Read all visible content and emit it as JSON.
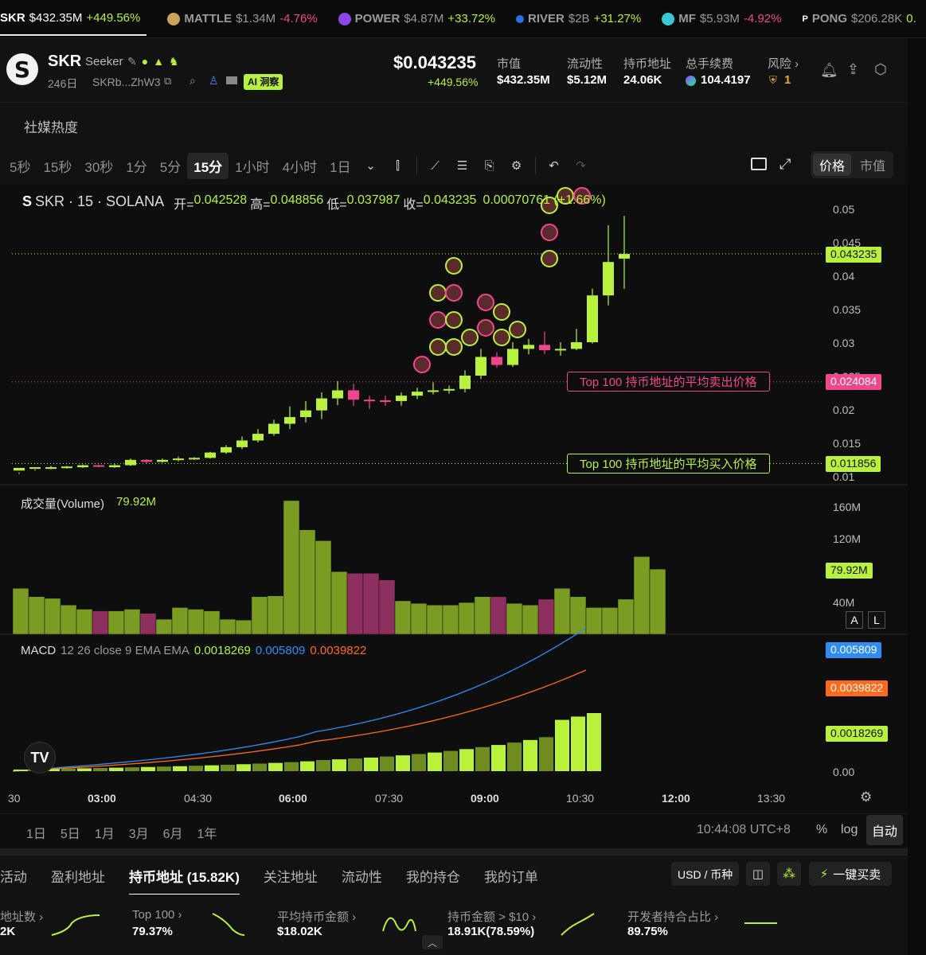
{
  "ticker": [
    {
      "symbol": "SKR",
      "value": "$432.35M",
      "change": "+449.56%",
      "dir": "up",
      "active": true
    },
    {
      "symbol": "MATTLE",
      "value": "$1.34M",
      "change": "-4.76%",
      "dir": "down"
    },
    {
      "symbol": "POWER",
      "value": "$4.87M",
      "change": "+33.72%",
      "dir": "up"
    },
    {
      "symbol": "RIVER",
      "value": "$2B",
      "change": "+31.27%",
      "dir": "up"
    },
    {
      "symbol": "MF",
      "value": "$5.93M",
      "change": "-4.92%",
      "dir": "down"
    },
    {
      "symbol": "PONG",
      "value": "$206.28K",
      "change": "0.",
      "dir": "up"
    }
  ],
  "header": {
    "symbol": "SKR",
    "name": "Seeker",
    "age": "246日",
    "address": "SKRb...ZhW3",
    "ai_badge": "AI 洞察",
    "price": "$0.043235",
    "price_change": "+449.56%",
    "stats": [
      {
        "label": "市值",
        "value": "$432.35M"
      },
      {
        "label": "流动性",
        "value": "$5.12M"
      },
      {
        "label": "持币地址",
        "value": "24.06K"
      },
      {
        "label": "总手续费",
        "value": "104.4197"
      },
      {
        "label": "风险 ›",
        "value": "1"
      }
    ]
  },
  "social": {
    "label": "社媒热度"
  },
  "toolbar": {
    "timeframes": [
      "5秒",
      "15秒",
      "30秒",
      "1分",
      "5分",
      "15分",
      "1小时",
      "4小时",
      "1日"
    ],
    "active": "15分",
    "price_toggle": "价格",
    "mcap_toggle": "市值"
  },
  "chart_data": {
    "type": "candlestick",
    "legend": {
      "title": "SKR · 15 · SOLANA",
      "open_label": "开=",
      "open": "0.042528",
      "high_label": "高=",
      "high": "0.048856",
      "low_label": "低=",
      "low": "0.037987",
      "close_label": "收=",
      "close": "0.043235",
      "change": "0.00070761 (+1.66%)"
    },
    "price_axis": [
      "0.05",
      "0.045",
      "0.04",
      "0.035",
      "0.03",
      "0.025",
      "0.02",
      "0.015",
      "0.01"
    ],
    "price_tags": {
      "current": "0.043235",
      "avg_sell": "0.024084",
      "avg_buy": "0.011856"
    },
    "avg_sell_label": "Top 100 持币地址的平均卖出价格",
    "avg_buy_label": "Top 100 持币地址的平均买入价格",
    "candles": [
      [
        0.0108,
        0.0112,
        0.0105,
        0.0103
      ],
      [
        0.0112,
        0.0113,
        0.011,
        0.0108
      ],
      [
        0.0112,
        0.0113,
        0.0115,
        0.011
      ],
      [
        0.0112,
        0.0114,
        0.0115,
        0.0111
      ],
      [
        0.0113,
        0.0116,
        0.0117,
        0.0112
      ],
      [
        0.0116,
        0.0114,
        0.0117,
        0.0113
      ],
      [
        0.0113,
        0.0116,
        0.0118,
        0.0112
      ],
      [
        0.0116,
        0.0124,
        0.0126,
        0.0115
      ],
      [
        0.0124,
        0.0121,
        0.0125,
        0.0118
      ],
      [
        0.0121,
        0.0124,
        0.0126,
        0.012
      ],
      [
        0.0124,
        0.0126,
        0.0129,
        0.0122
      ],
      [
        0.0126,
        0.0127,
        0.0128,
        0.0124
      ],
      [
        0.0127,
        0.0135,
        0.0136,
        0.0126
      ],
      [
        0.0135,
        0.0143,
        0.0146,
        0.0133
      ],
      [
        0.0143,
        0.0153,
        0.0159,
        0.014
      ],
      [
        0.0153,
        0.0163,
        0.017,
        0.015
      ],
      [
        0.0163,
        0.0178,
        0.0184,
        0.016
      ],
      [
        0.0178,
        0.0188,
        0.0204,
        0.017
      ],
      [
        0.0188,
        0.0198,
        0.0212,
        0.018
      ],
      [
        0.0198,
        0.0216,
        0.0225,
        0.0185
      ],
      [
        0.0216,
        0.0228,
        0.0242,
        0.0206
      ],
      [
        0.0228,
        0.0214,
        0.0238,
        0.0205
      ],
      [
        0.0214,
        0.0213,
        0.022,
        0.02
      ],
      [
        0.0213,
        0.0212,
        0.022,
        0.0205
      ],
      [
        0.0212,
        0.022,
        0.0225,
        0.0205
      ],
      [
        0.022,
        0.0226,
        0.0232,
        0.0215
      ],
      [
        0.0226,
        0.0228,
        0.024,
        0.0222
      ],
      [
        0.0228,
        0.023,
        0.0235,
        0.0223
      ],
      [
        0.023,
        0.025,
        0.0258,
        0.0225
      ],
      [
        0.025,
        0.0278,
        0.029,
        0.0245
      ],
      [
        0.0278,
        0.0266,
        0.0285,
        0.0262
      ],
      [
        0.0266,
        0.029,
        0.03,
        0.0263
      ],
      [
        0.029,
        0.0296,
        0.0305,
        0.0282
      ],
      [
        0.0296,
        0.0288,
        0.0316,
        0.0282
      ],
      [
        0.0288,
        0.029,
        0.03,
        0.028
      ],
      [
        0.029,
        0.03,
        0.032,
        0.0288
      ],
      [
        0.03,
        0.037,
        0.038,
        0.0298
      ],
      [
        0.037,
        0.042,
        0.0475,
        0.0355
      ],
      [
        0.0425,
        0.0432,
        0.0489,
        0.038
      ]
    ],
    "volume": {
      "label": "成交量(Volume)",
      "value": "79.92M",
      "axis": [
        "160M",
        "120M",
        "40M"
      ],
      "bars": [
        55,
        45,
        43,
        35,
        30,
        28,
        28,
        30,
        25,
        18,
        32,
        30,
        28,
        18,
        17,
        45,
        46,
        160,
        125,
        112,
        75,
        73,
        73,
        65,
        40,
        37,
        35,
        35,
        38,
        45,
        45,
        37,
        35,
        42,
        55,
        45,
        32,
        32,
        42,
        93,
        78
      ]
    },
    "macd": {
      "label": "MACD",
      "params": "12 26 close 9 EMA EMA",
      "hist": "0.0018269",
      "macd": "0.005809",
      "signal": "0.0039822",
      "axis_zero": "0.00"
    },
    "time_axis": [
      "30",
      "03:00",
      "04:30",
      "06:00",
      "07:30",
      "09:00",
      "10:30",
      "12:00",
      "13:30"
    ]
  },
  "bottombar": {
    "ranges": [
      "1日",
      "5日",
      "1月",
      "3月",
      "6月",
      "1年"
    ],
    "clock": "10:44:08 UTC+8",
    "pct": "%",
    "log": "log",
    "auto": "自动"
  },
  "tabs": [
    "活动",
    "盈利地址",
    "持币地址 (15.82K)",
    "关注地址",
    "流动性",
    "我的持仓",
    "我的订单"
  ],
  "tabs_active": "持币地址 (15.82K)",
  "tabs_right": {
    "currency": "USD / 币种",
    "quick_buy": "一键买卖"
  },
  "holder_stats": [
    {
      "label": "地址数 ›",
      "value": "2K"
    },
    {
      "label": "Top 100 ›",
      "value": "79.37%"
    },
    {
      "label": "平均持币金额 ›",
      "value": "$18.02K"
    },
    {
      "label": "持币金额 > $10 ›",
      "value": "18.91K(78.59%)"
    },
    {
      "label": "开发者持合占比 ›",
      "value": "89.75%"
    }
  ],
  "colors": {
    "up": "#b8f23c",
    "down": "#f0468e",
    "bg": "#0e0e0e",
    "macd_line": "#2f8df5",
    "signal_line": "#ff6a1a"
  }
}
